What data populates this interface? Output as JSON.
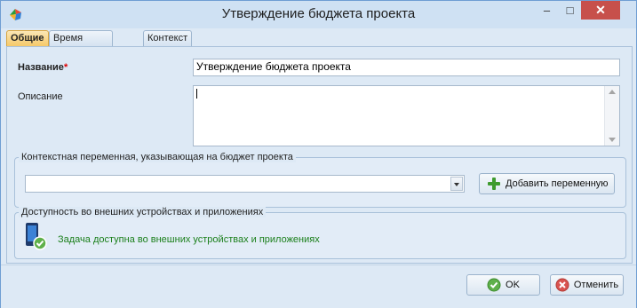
{
  "window": {
    "title": "Утверждение бюджета проекта",
    "minimize": "–",
    "maximize": "□",
    "close": "✕"
  },
  "tabs": [
    {
      "label": "Общие"
    },
    {
      "label": "Время выполнения"
    },
    {
      "label": "Контекст"
    }
  ],
  "form": {
    "name_label": "Название",
    "required_mark": "*",
    "name_value": "Утверждение бюджета проекта",
    "description_label": "Описание",
    "description_value": ""
  },
  "context_group": {
    "legend": "Контекстная переменная, указывающая на бюджет проекта",
    "select_value": "",
    "add_button": "Добавить переменную"
  },
  "availability_group": {
    "legend": "Доступность во внешних устройствах и приложениях",
    "status_text": "Задача доступна во внешних устройствах и приложениях",
    "status_color": "#1a7f1a"
  },
  "footer": {
    "ok": "OK",
    "cancel": "Отменить"
  }
}
